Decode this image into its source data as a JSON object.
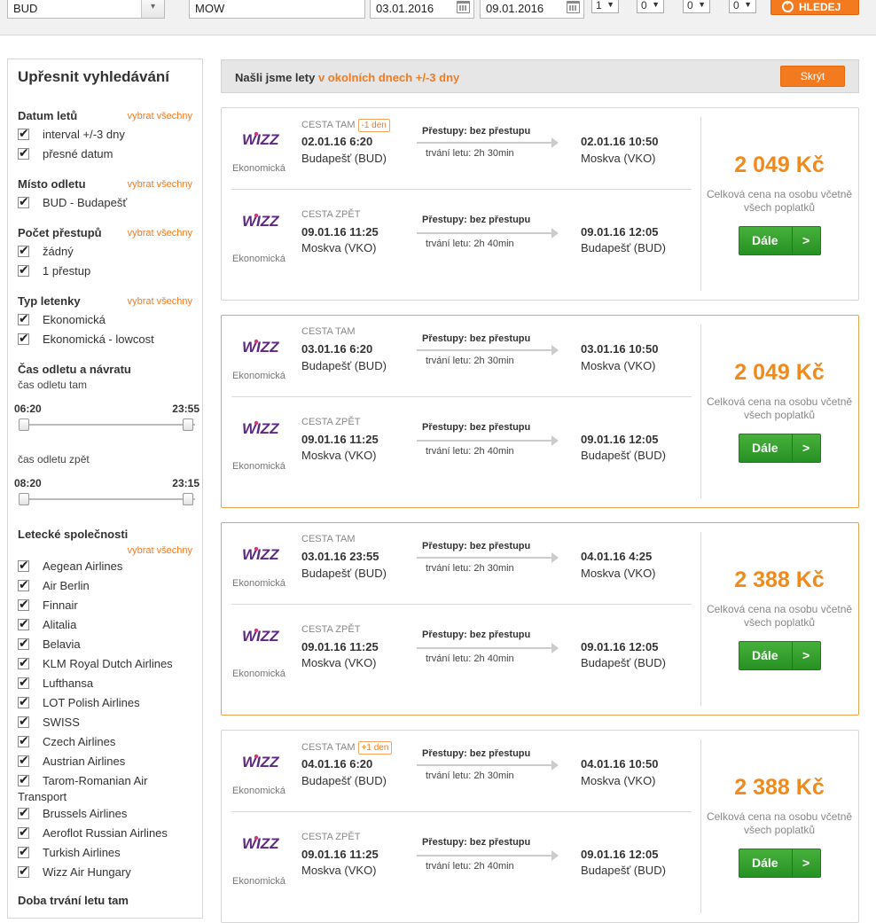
{
  "search": {
    "from": "BUD",
    "to": "MOW",
    "depart_date": "03.01.2016",
    "return_date": "09.01.2016",
    "adults": "1",
    "children": "0",
    "infants": "0",
    "extra": "0",
    "button_label": "HLEDEJ"
  },
  "sidebar": {
    "title": "Upřesnit vyhledávání",
    "select_all": "vybrat všechny",
    "dates": {
      "title": "Datum letů",
      "items": [
        "interval +/-3 dny",
        "přesné datum"
      ]
    },
    "origin": {
      "title": "Místo odletu",
      "items": [
        "BUD - Budapešť"
      ]
    },
    "stops": {
      "title": "Počet přestupů",
      "items": [
        "žádný",
        "1 přestup"
      ]
    },
    "ticket": {
      "title": "Typ letenky",
      "items": [
        "Ekonomická",
        "Ekonomická - lowcost"
      ]
    },
    "times": {
      "title": "Čas odletu a návratu",
      "out_label": "čas odletu tam",
      "out_min": "06:20",
      "out_max": "23:55",
      "back_label": "čas odletu zpět",
      "back_min": "08:20",
      "back_max": "23:15"
    },
    "airlines": {
      "title": "Letecké společnosti",
      "items": [
        "Aegean Airlines",
        "Air Berlin",
        "Finnair",
        "Alitalia",
        "Belavia",
        "KLM Royal Dutch Airlines",
        "Lufthansa",
        "LOT Polish Airlines",
        "SWISS",
        "Czech Airlines",
        "Austrian Airlines",
        "Tarom-Romanian Air",
        "Brussels Airlines",
        "Aeroflot Russian Airlines",
        "Turkish Airlines",
        "Wizz Air Hungary"
      ],
      "wrap_tail": "Transport"
    },
    "duration_title": "Doba trvání letu tam"
  },
  "notice": {
    "text": "Našli jsme lety",
    "highlight": "v okolních dnech +/-3 dny",
    "hide_label": "Skrýt"
  },
  "labels": {
    "transfers": "Přestupy: bez přestupu",
    "out_dir": "CESTA TAM",
    "back_dir": "CESTA ZPĚT",
    "class": "Ekonomická",
    "price_note": "Celková cena na osobu včetně všech poplatků",
    "next": "Dále",
    "next_arrow": ">",
    "logo": "WIZZ"
  },
  "results": [
    {
      "price": "2 049 Kč",
      "out": {
        "tag": "-1 den",
        "dep": "02.01.16 6:20",
        "from": "Budapešť (BUD)",
        "duration": "trvání letu: 2h 30min",
        "arr": "02.01.16 10:50",
        "to": "Moskva (VKO)"
      },
      "back": {
        "tag": "",
        "dep": "09.01.16 11:25",
        "from": "Moskva (VKO)",
        "duration": "trvání letu: 2h 40min",
        "arr": "09.01.16 12:05",
        "to": "Budapešť (BUD)"
      }
    },
    {
      "price": "2 049 Kč",
      "out": {
        "tag": "",
        "dep": "03.01.16 6:20",
        "from": "Budapešť (BUD)",
        "duration": "trvání letu: 2h 30min",
        "arr": "03.01.16 10:50",
        "to": "Moskva (VKO)"
      },
      "back": {
        "tag": "",
        "dep": "09.01.16 11:25",
        "from": "Moskva (VKO)",
        "duration": "trvání letu: 2h 40min",
        "arr": "09.01.16 12:05",
        "to": "Budapešť (BUD)"
      }
    },
    {
      "price": "2 388 Kč",
      "out": {
        "tag": "",
        "dep": "03.01.16 23:55",
        "from": "Budapešť (BUD)",
        "duration": "trvání letu: 2h 30min",
        "arr": "04.01.16 4:25",
        "to": "Moskva (VKO)"
      },
      "back": {
        "tag": "",
        "dep": "09.01.16 11:25",
        "from": "Moskva (VKO)",
        "duration": "trvání letu: 2h 40min",
        "arr": "09.01.16 12:05",
        "to": "Budapešť (BUD)"
      }
    },
    {
      "price": "2 388 Kč",
      "out": {
        "tag": "+1 den",
        "dep": "04.01.16 6:20",
        "from": "Budapešť (BUD)",
        "duration": "trvání letu: 2h 30min",
        "arr": "04.01.16 10:50",
        "to": "Moskva (VKO)"
      },
      "back": {
        "tag": "",
        "dep": "09.01.16 11:25",
        "from": "Moskva (VKO)",
        "duration": "trvání letu: 2h 40min",
        "arr": "09.01.16 12:05",
        "to": "Budapešť (BUD)"
      }
    }
  ],
  "colors": {
    "accent": "#f47a1f",
    "price": "#f08a1c",
    "next_button": "#3aa32f",
    "highlight_border": "#e8a44a"
  }
}
